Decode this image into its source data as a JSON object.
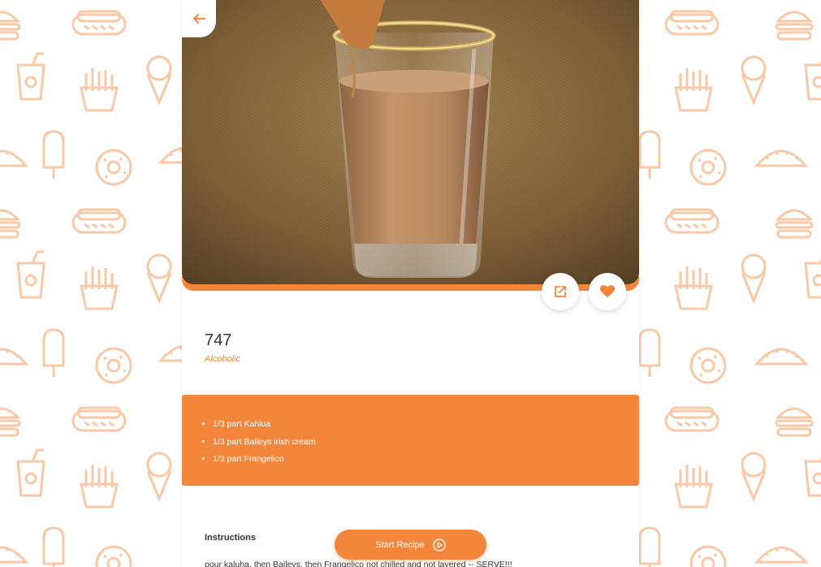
{
  "colors": {
    "accent": "#f4863b",
    "pattern": "#f9c8a7",
    "text": "#333333"
  },
  "recipe": {
    "title": "747",
    "category": "Alcoholic",
    "ingredients": [
      "1/3 part Kahlua",
      "1/3 part Baileys irish cream",
      "1/3 part Frangelico"
    ],
    "instructions_heading": "Instructions",
    "instructions_text": "pour kaluha, then Baileys, then Frangelico not chilled and not layered -- SERVE!!!"
  },
  "actions": {
    "back_icon": "arrow-left-icon",
    "share_icon": "external-link-icon",
    "favorite_icon": "heart-icon",
    "start_label": "Start Recipe",
    "start_icon": "play-circle-icon"
  },
  "background_icons": [
    "hotdog-icon",
    "burger-icon",
    "soda-cup-icon",
    "fries-icon",
    "ice-cream-icon",
    "popsicle-icon",
    "donut-icon",
    "taco-icon"
  ]
}
